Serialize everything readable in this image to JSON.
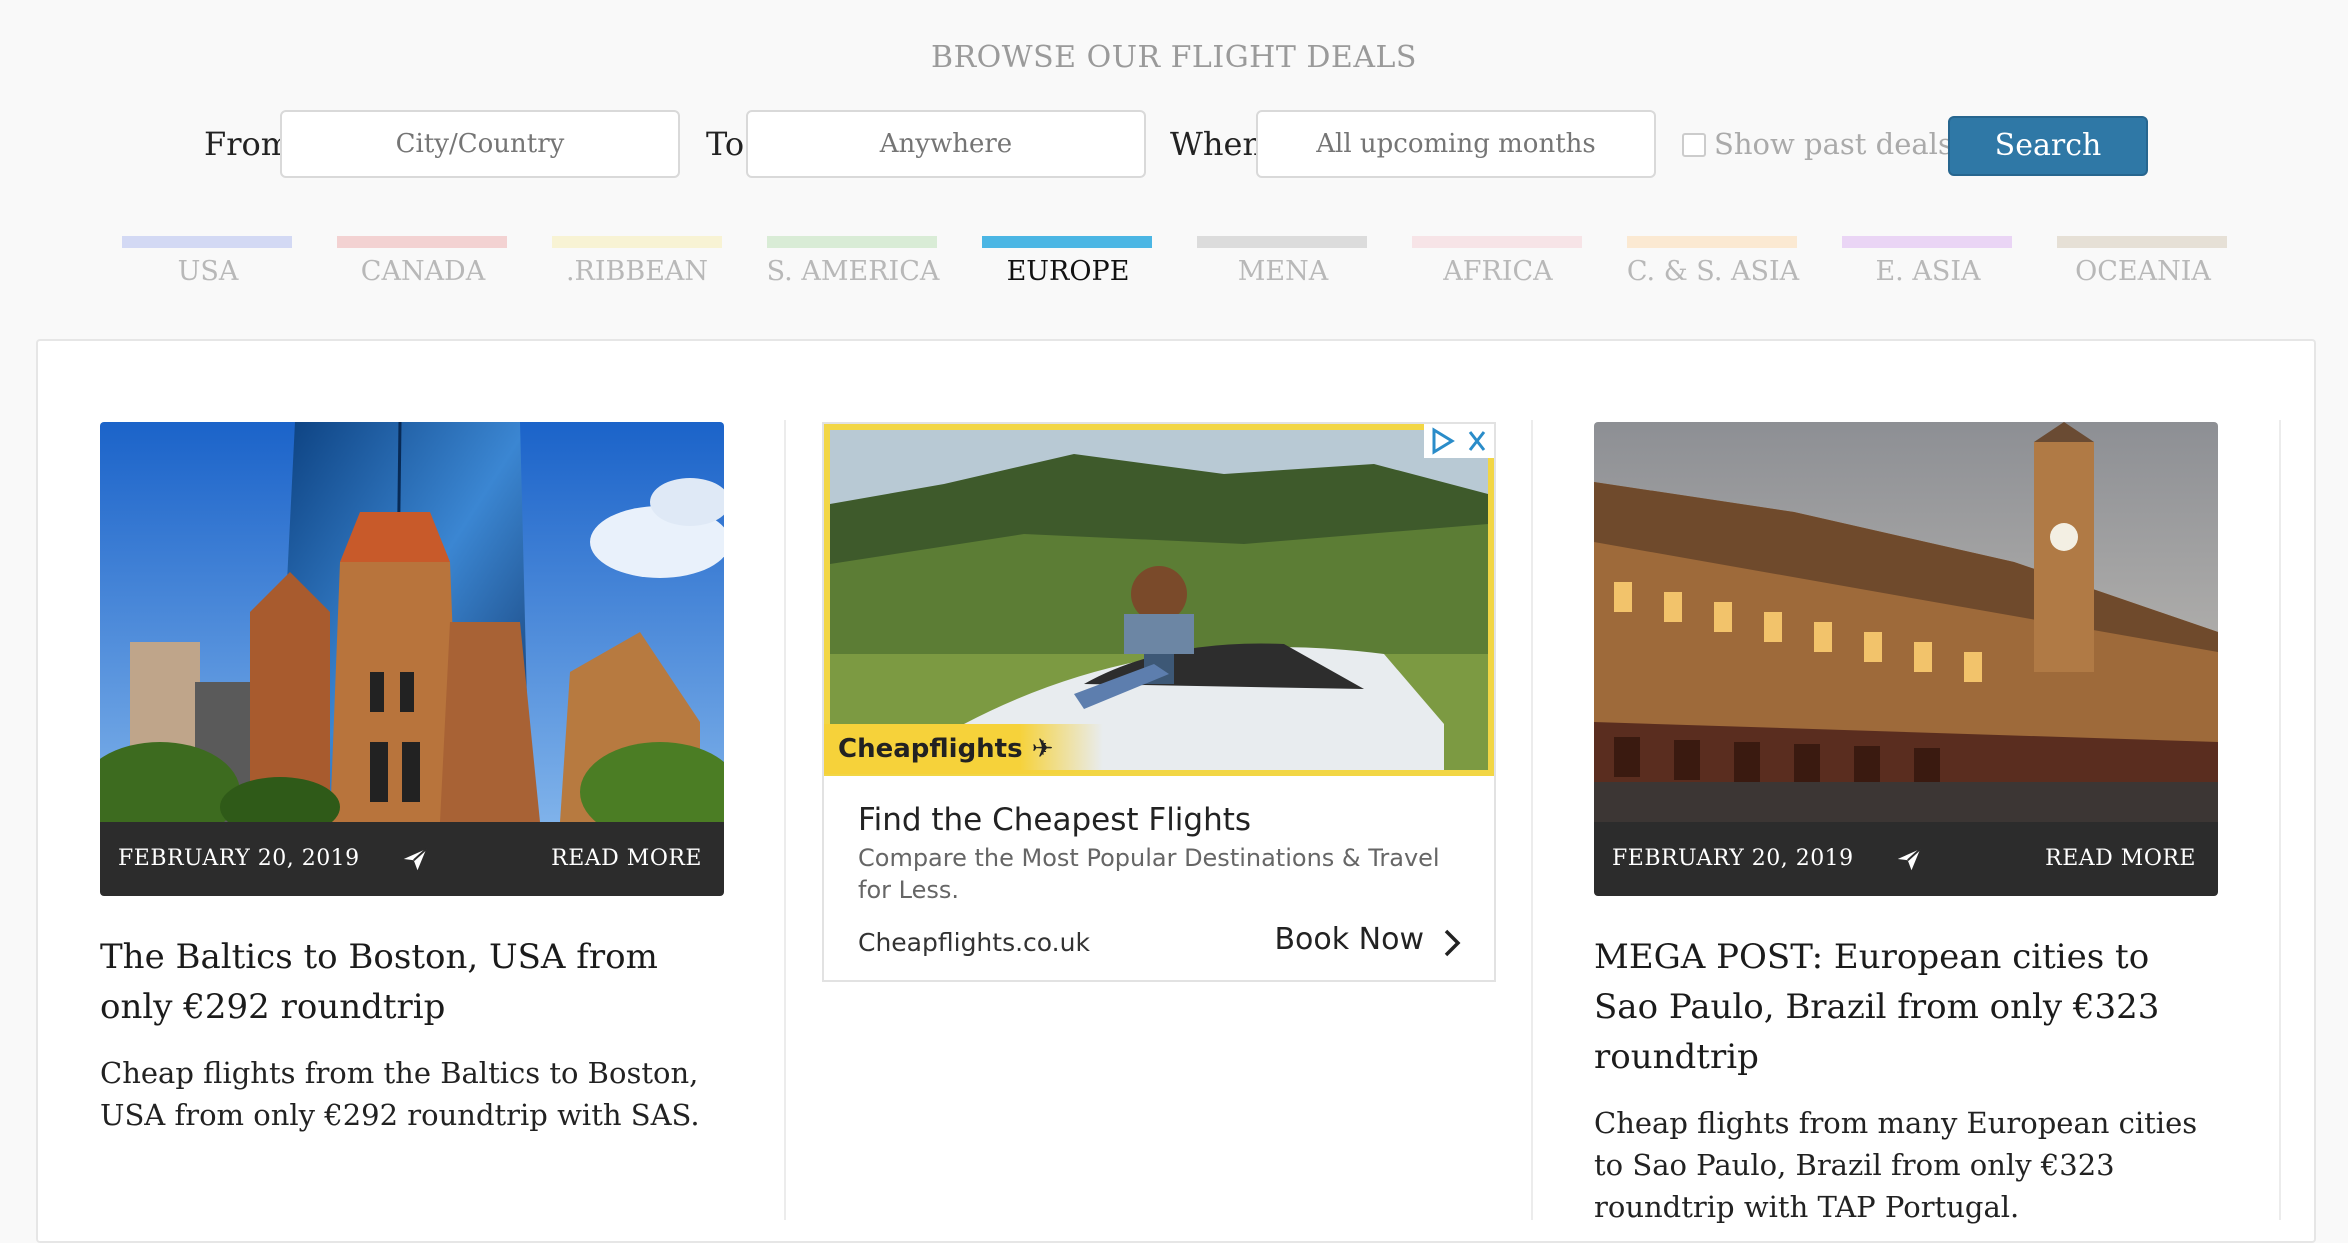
{
  "heading": "BROWSE OUR FLIGHT DEALS",
  "search": {
    "from_label": "From",
    "from_placeholder": "City/Country",
    "to_label": "To",
    "to_placeholder": "Anywhere",
    "when_label": "When",
    "when_placeholder": "All upcoming months",
    "past_deals_label": "Show past deals",
    "search_button": "Search"
  },
  "regions": [
    {
      "label": "USA",
      "color": "#d3d9f4",
      "active": false
    },
    {
      "label": "CANADA",
      "color": "#f3d2d2",
      "active": false
    },
    {
      "label": ".RIBBEAN",
      "color": "#f8f3d4",
      "active": false
    },
    {
      "label": "S. AMERICA",
      "color": "#d9ecd6",
      "active": false
    },
    {
      "label": "EUROPE",
      "color": "#4bb6e4",
      "active": true
    },
    {
      "label": "MENA",
      "color": "#dcdcdc",
      "active": false
    },
    {
      "label": "AFRICA",
      "color": "#f7e4e7",
      "active": false
    },
    {
      "label": "C. & S. ASIA",
      "color": "#fbe9d2",
      "active": false
    },
    {
      "label": "E. ASIA",
      "color": "#ead5f5",
      "active": false
    },
    {
      "label": "OCEANIA",
      "color": "#e6e0d6",
      "active": false
    }
  ],
  "posts": [
    {
      "date": "FEBRUARY 20, 2019",
      "read_more": "READ MORE",
      "title": "The Baltics to Boston, USA from only €292 roundtrip",
      "description": "Cheap flights from the Baltics to Boston, USA from only €292 roundtrip with SAS."
    },
    {
      "date": "FEBRUARY 20, 2019",
      "read_more": "READ MORE",
      "title": "MEGA POST: European cities to Sao Paulo, Brazil from only €323 roundtrip",
      "description": "Cheap flights from many European cities to Sao Paulo, Brazil from only €323 roundtrip with TAP Portugal."
    }
  ],
  "ad": {
    "brand": "Cheapflights",
    "title": "Find the Cheapest Flights",
    "description": "Compare the Most Popular Destinations & Travel for Less.",
    "url": "Cheapflights.co.uk",
    "cta": "Book Now"
  },
  "icons": {
    "share": "paper-plane-icon",
    "ad_choices": "ad-choices-icon",
    "close": "close-icon",
    "chevron": "chevron-right-icon"
  }
}
